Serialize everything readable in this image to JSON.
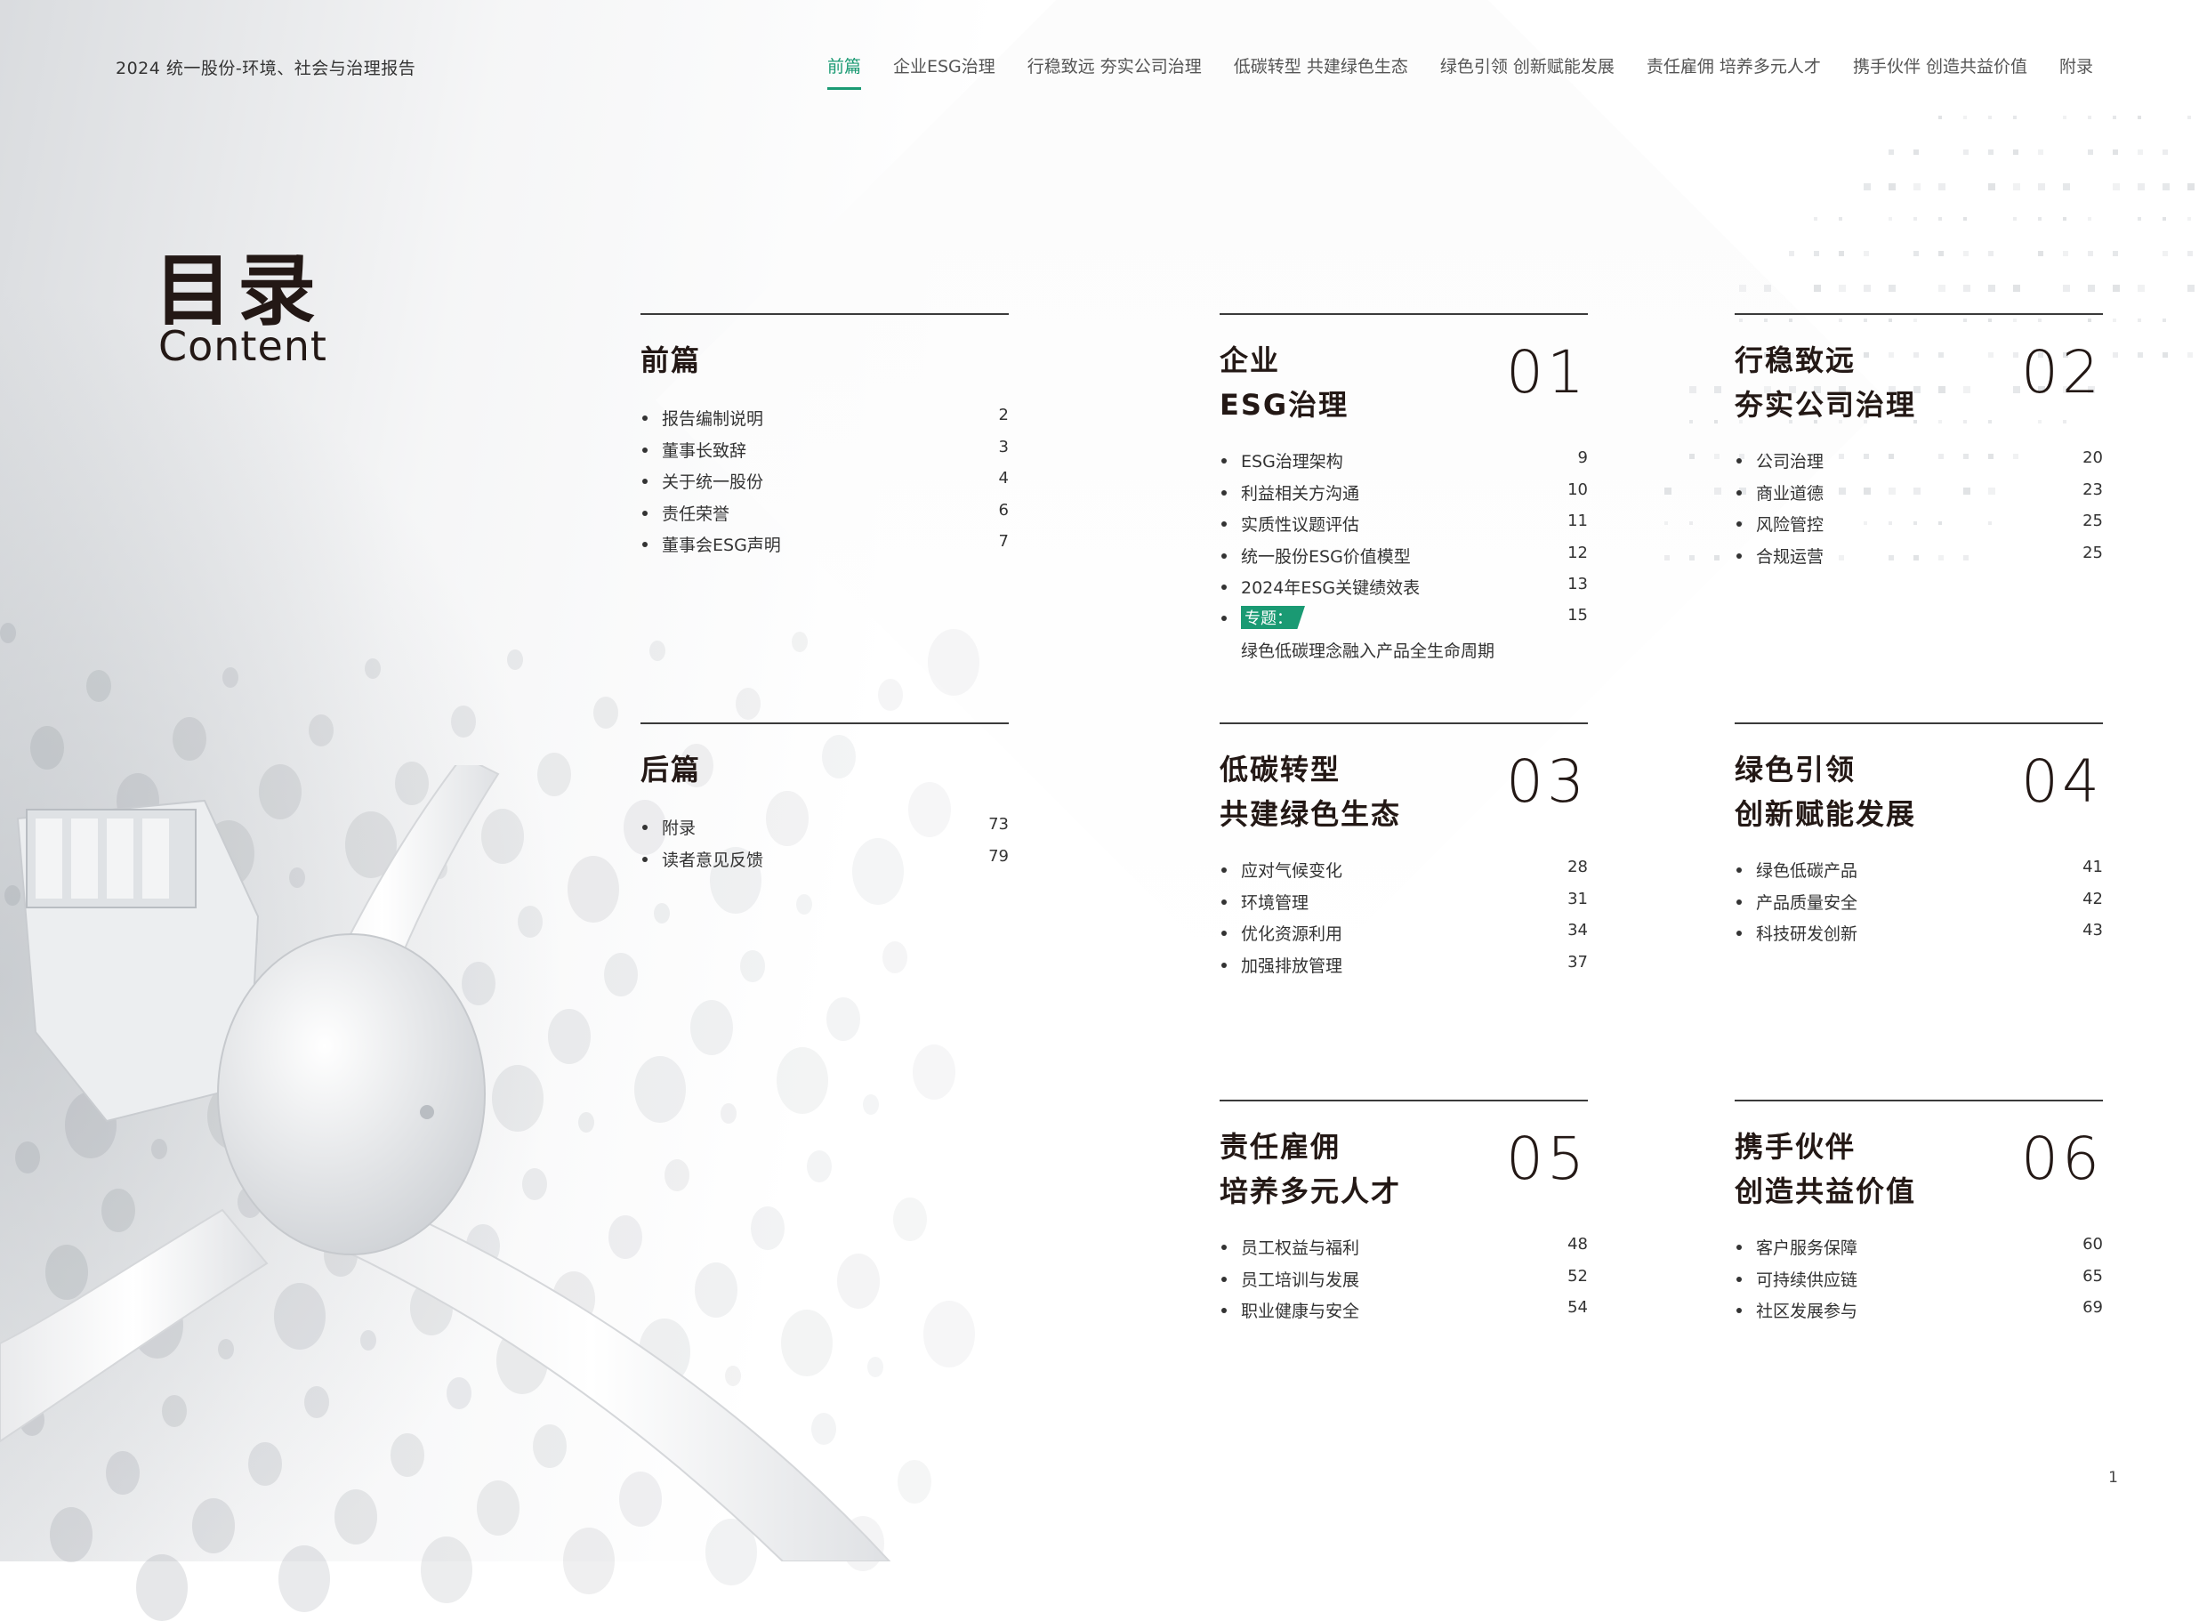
{
  "header": {
    "doc_title": "2024 统一股份-环境、社会与治理报告",
    "nav": [
      "前篇",
      "企业ESG治理",
      "行稳致远 夯实公司治理",
      "低碳转型 共建绿色生态",
      "绿色引领 创新赋能发展",
      "责任雇佣 培养多元人才",
      "携手伙伴 创造共益价值",
      "附录"
    ],
    "active_nav": "前篇"
  },
  "toc": {
    "title": "目录",
    "subtitle": "Content"
  },
  "sections": {
    "preface": {
      "title": "前篇",
      "items": [
        {
          "label": "报告编制说明",
          "page": "2"
        },
        {
          "label": "董事长致辞",
          "page": "3"
        },
        {
          "label": "关于统一股份",
          "page": "4"
        },
        {
          "label": "责任荣誉",
          "page": "6"
        },
        {
          "label": "董事会ESG声明",
          "page": "7"
        }
      ]
    },
    "s01": {
      "title_line1": "企业",
      "title_line2": "ESG治理",
      "number": "01",
      "items": [
        {
          "label": "ESG治理架构",
          "page": "9"
        },
        {
          "label": "利益相关方沟通",
          "page": "10"
        },
        {
          "label": "实质性议题评估",
          "page": "11"
        },
        {
          "label": "统一股份ESG价值模型",
          "page": "12"
        },
        {
          "label": "2024年ESG关键绩效表",
          "page": "13"
        }
      ],
      "special": {
        "tag": "专题：",
        "label": "绿色低碳理念融入产品全生命周期",
        "page": "15"
      }
    },
    "s02": {
      "title_line1": "行稳致远",
      "title_line2": "夯实公司治理",
      "number": "02",
      "items": [
        {
          "label": "公司治理",
          "page": "20"
        },
        {
          "label": "商业道德",
          "page": "23"
        },
        {
          "label": "风险管控",
          "page": "25"
        },
        {
          "label": "合规运营",
          "page": "25"
        }
      ]
    },
    "postface": {
      "title": "后篇",
      "items": [
        {
          "label": "附录",
          "page": "73"
        },
        {
          "label": "读者意见反馈",
          "page": "79"
        }
      ]
    },
    "s03": {
      "title_line1": "低碳转型",
      "title_line2": "共建绿色生态",
      "number": "03",
      "items": [
        {
          "label": "应对气候变化",
          "page": "28"
        },
        {
          "label": "环境管理",
          "page": "31"
        },
        {
          "label": "优化资源利用",
          "page": "34"
        },
        {
          "label": "加强排放管理",
          "page": "37"
        }
      ]
    },
    "s04": {
      "title_line1": "绿色引领",
      "title_line2": "创新赋能发展",
      "number": "04",
      "items": [
        {
          "label": "绿色低碳产品",
          "page": "41"
        },
        {
          "label": "产品质量安全",
          "page": "42"
        },
        {
          "label": "科技研发创新",
          "page": "43"
        }
      ]
    },
    "s05": {
      "title_line1": "责任雇佣",
      "title_line2": "培养多元人才",
      "number": "05",
      "items": [
        {
          "label": "员工权益与福利",
          "page": "48"
        },
        {
          "label": "员工培训与发展",
          "page": "52"
        },
        {
          "label": "职业健康与安全",
          "page": "54"
        }
      ]
    },
    "s06": {
      "title_line1": "携手伙伴",
      "title_line2": "创造共益价值",
      "number": "06",
      "items": [
        {
          "label": "客户服务保障",
          "page": "60"
        },
        {
          "label": "可持续供应链",
          "page": "65"
        },
        {
          "label": "社区发展参与",
          "page": "69"
        }
      ]
    }
  },
  "footer": {
    "page_number": "1"
  },
  "colors": {
    "accent": "#1a9a73",
    "text": "#231815"
  }
}
